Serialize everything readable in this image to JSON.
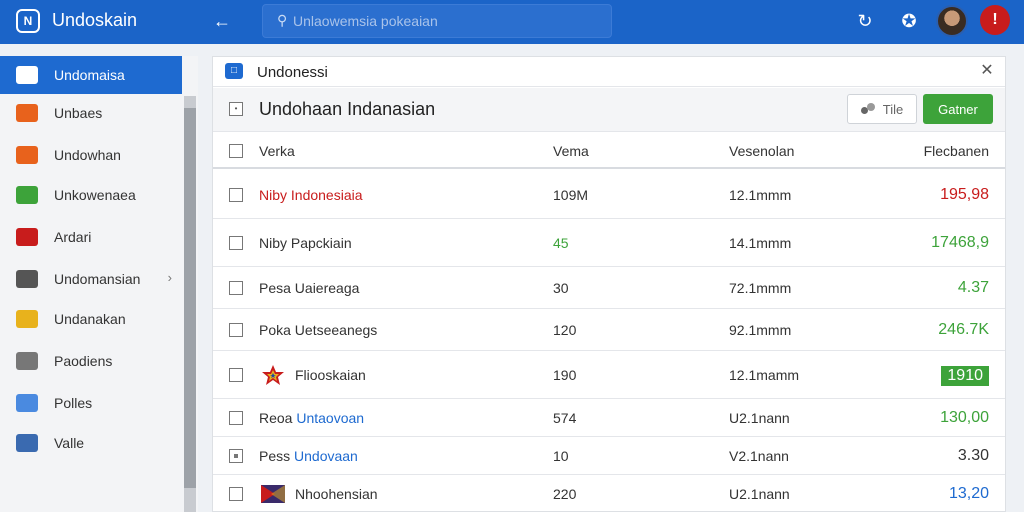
{
  "app": {
    "logo_text": "N",
    "title": "Undoskain"
  },
  "topbar": {
    "back_icon": "arrow-left-icon",
    "search_placeholder": "Unlaowemsia pokeaian",
    "icons": [
      "refresh-icon",
      "puzzle-icon"
    ],
    "alert_badge": "!"
  },
  "sidebar": {
    "items": [
      {
        "label": "Undomaisa",
        "icon": "card-icon",
        "color": "#ffffff",
        "active": true
      },
      {
        "label": "Unbaes",
        "icon": "flag-icon",
        "color": "#e8621c"
      },
      {
        "label": "Undowhan",
        "icon": "gift-icon",
        "color": "#e8621c"
      },
      {
        "label": "Unkowenaea",
        "icon": "battery-icon",
        "color": "#3da33a"
      },
      {
        "label": "Ardari",
        "icon": "document-icon",
        "color": "#c81c1c"
      },
      {
        "label": "Undomansian",
        "icon": "folder-icon",
        "color": "#555555",
        "chevron": true
      },
      {
        "label": "Undanakan",
        "icon": "coins-icon",
        "color": "#e8b21c"
      },
      {
        "label": "Paodiens",
        "icon": "user-icon",
        "color": "#777777"
      },
      {
        "label": "Polles",
        "icon": "globe-icon",
        "color": "#4a8ae0"
      },
      {
        "label": "Valle",
        "icon": "network-icon",
        "color": "#3a6ab0"
      }
    ]
  },
  "panel": {
    "title": "Undonessi",
    "subtitle": "Undohaan Indanasian",
    "file_button": "Tile",
    "primary_button": "Gatner",
    "columns": [
      "Verka",
      "Vema",
      "Vesenolan",
      "Flecbanen"
    ],
    "rows": [
      {
        "name": "Niby Indonesiaia",
        "name_color": "#c81c1c",
        "vema": "109M",
        "vema_color": "#333333",
        "vesenolan": "12.1mmm",
        "amount": "195,98",
        "amount_color": "#c81c1c",
        "icon": "",
        "check": "box"
      },
      {
        "name": "Niby Papckiain",
        "name_color": "#333333",
        "vema": "45",
        "vema_color": "#3da33a",
        "vesenolan": "14.1mmm",
        "amount": "17468,9",
        "amount_color": "#3da33a",
        "icon": "",
        "check": "box"
      },
      {
        "name": "Pesa Uaiereaga",
        "name_color": "#333333",
        "vema": "30",
        "vema_color": "#333333",
        "vesenolan": "72.1mmm",
        "amount": "4.37",
        "amount_color": "#3da33a",
        "icon": "",
        "check": "box"
      },
      {
        "name": "Poka Uetseeanegs",
        "name_color": "#333333",
        "vema": "120",
        "vema_color": "#333333",
        "vesenolan": "92.1mmm",
        "amount": "246.7K",
        "amount_color": "#3da33a",
        "icon": "",
        "check": "box"
      },
      {
        "name": "Fliooskaian",
        "name_color": "#333333",
        "vema": "190",
        "vema_color": "#333333",
        "vesenolan": "12.1mamm",
        "amount": "1910",
        "amount_color": "#ffffff",
        "amount_boxed": true,
        "icon": "star-flag-icon",
        "check": "box"
      },
      {
        "name_prefix": "Reoa",
        "name": "Untaovoan",
        "name_color": "#1e6ad0",
        "vema": "574",
        "vema_color": "#333333",
        "vesenolan": "U2.1nann",
        "amount": "130,00",
        "amount_color": "#3da33a",
        "icon": "",
        "check": "box"
      },
      {
        "name_prefix": "Pess",
        "name": "Undovaan",
        "name_color": "#1e6ad0",
        "vema": "10",
        "vema_color": "#333333",
        "vesenolan": "V2.1nann",
        "amount": "3.30",
        "amount_color": "#333333",
        "icon": "",
        "check": "dot"
      },
      {
        "name": "Nhoohensian",
        "name_color": "#333333",
        "vema": "220",
        "vema_color": "#333333",
        "vesenolan": "U2.1nann",
        "amount": "13,20",
        "amount_color": "#1e6ad0",
        "icon": "triangle-flag-icon",
        "check": "box"
      }
    ]
  }
}
